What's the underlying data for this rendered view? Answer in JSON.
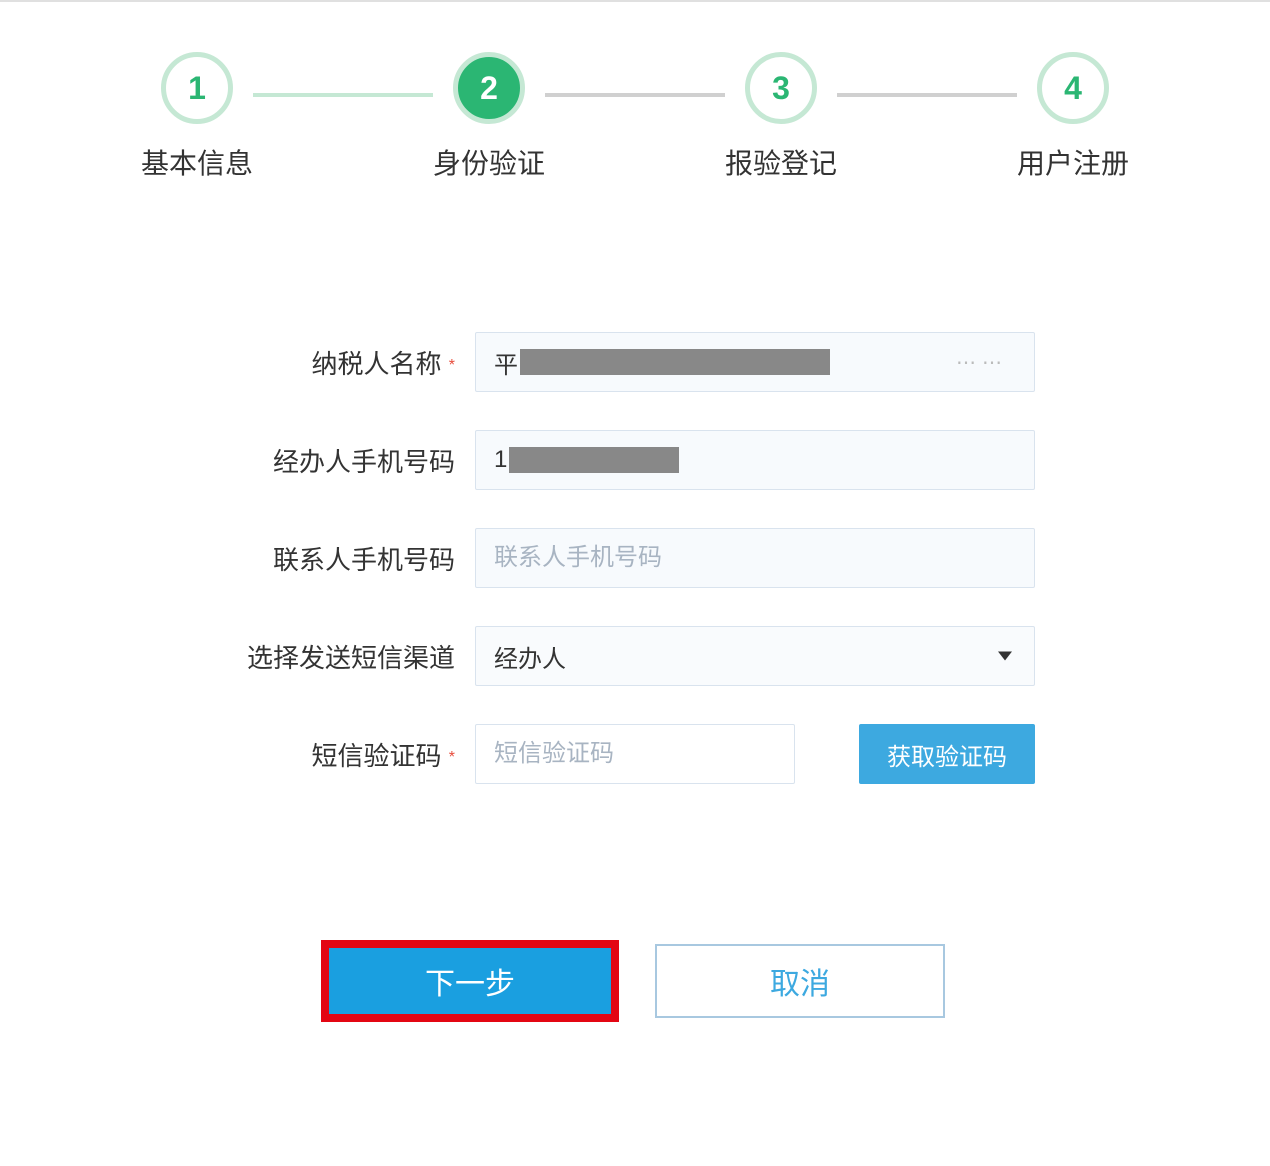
{
  "stepper": {
    "steps": [
      {
        "num": "1",
        "label": "基本信息"
      },
      {
        "num": "2",
        "label": "身份验证"
      },
      {
        "num": "3",
        "label": "报验登记"
      },
      {
        "num": "4",
        "label": "用户注册"
      }
    ]
  },
  "form": {
    "taxpayer_name_label": "纳税人名称",
    "taxpayer_name_prefix": "平",
    "agent_phone_label": "经办人手机号码",
    "agent_phone_prefix": "1",
    "contact_phone_label": "联系人手机号码",
    "contact_phone_placeholder": "联系人手机号码",
    "sms_channel_label": "选择发送短信渠道",
    "sms_channel_value": "经办人",
    "sms_code_label": "短信验证码",
    "sms_code_placeholder": "短信验证码",
    "get_code_btn": "获取验证码",
    "required_mark": "*"
  },
  "actions": {
    "next": "下一步",
    "cancel": "取消"
  }
}
